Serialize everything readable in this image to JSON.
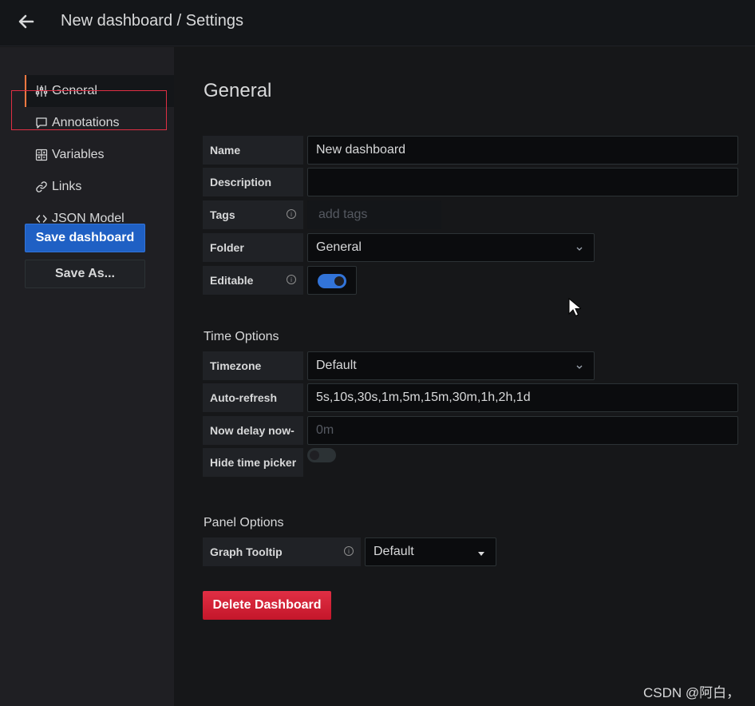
{
  "header": {
    "title": "New dashboard / Settings"
  },
  "sidebar": {
    "items": [
      {
        "label": "General",
        "icon": "sliders-icon"
      },
      {
        "label": "Annotations",
        "icon": "comment-icon"
      },
      {
        "label": "Variables",
        "icon": "calculator-icon"
      },
      {
        "label": "Links",
        "icon": "link-icon"
      },
      {
        "label": "JSON Model",
        "icon": "code-icon"
      }
    ],
    "save_label": "Save dashboard",
    "save_as_label": "Save As..."
  },
  "main": {
    "title": "General",
    "fields": {
      "name": {
        "label": "Name",
        "value": "New dashboard"
      },
      "description": {
        "label": "Description",
        "value": ""
      },
      "tags": {
        "label": "Tags",
        "placeholder": "add tags"
      },
      "folder": {
        "label": "Folder",
        "value": "General"
      },
      "editable": {
        "label": "Editable",
        "value": true
      }
    },
    "time_options": {
      "title": "Time Options",
      "timezone": {
        "label": "Timezone",
        "value": "Default"
      },
      "auto_refresh": {
        "label": "Auto-refresh",
        "value": "5s,10s,30s,1m,5m,15m,30m,1h,2h,1d"
      },
      "now_delay": {
        "label": "Now delay now-",
        "placeholder": "0m"
      },
      "hide_time_picker": {
        "label": "Hide time picker",
        "value": false
      }
    },
    "panel_options": {
      "title": "Panel Options",
      "graph_tooltip": {
        "label": "Graph Tooltip",
        "value": "Default"
      }
    },
    "delete_label": "Delete Dashboard"
  },
  "watermark": "CSDN @阿白，",
  "colors": {
    "accent": "#ff7941",
    "primary": "#1f60c4",
    "danger": "#e02f44",
    "highlight": "#e02f44"
  }
}
